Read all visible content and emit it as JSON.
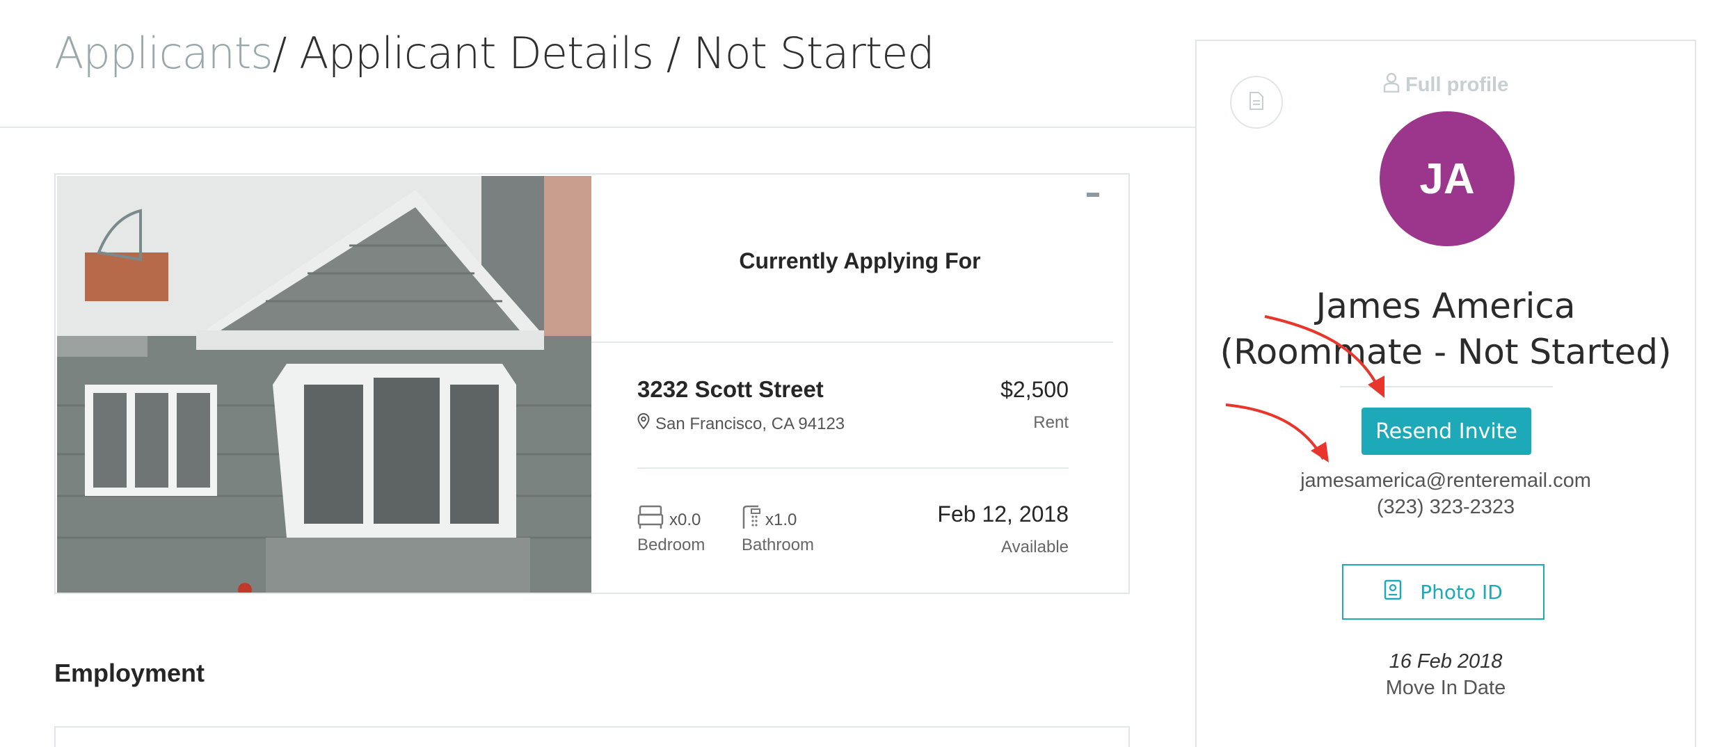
{
  "header": {
    "breadcrumb_root": "Applicants",
    "breadcrumb_rest": "/ Applicant Details / Not Started"
  },
  "property": {
    "section_title": "Currently Applying For",
    "street": "3232 Scott Street",
    "city": "San Francisco, CA 94123",
    "rent_value": "$2,500",
    "rent_label": "Rent",
    "bedroom_count": "x0.0",
    "bedroom_label": "Bedroom",
    "bathroom_count": "x1.0",
    "bathroom_label": "Bathroom",
    "available_date": "Feb 12, 2018",
    "available_label": "Available"
  },
  "employment": {
    "title": "Employment"
  },
  "profile": {
    "full_profile_label": "Full profile",
    "initials": "JA",
    "name_line1": "James America",
    "name_line2": "(Roommate - Not Started)",
    "resend_label": "Resend Invite",
    "email": "jamesamerica@renteremail.com",
    "phone": "(323) 323-2323",
    "photo_id_label": "Photo ID",
    "move_in_date": "16 Feb 2018",
    "move_in_label": "Move In Date"
  },
  "colors": {
    "accent": "#1ea9b8",
    "avatar": "#9c368d",
    "annotation_arrow": "#e8362c"
  },
  "icons": [
    "document-icon",
    "user-icon",
    "map-pin-icon",
    "bed-icon",
    "bath-icon",
    "id-card-icon"
  ]
}
